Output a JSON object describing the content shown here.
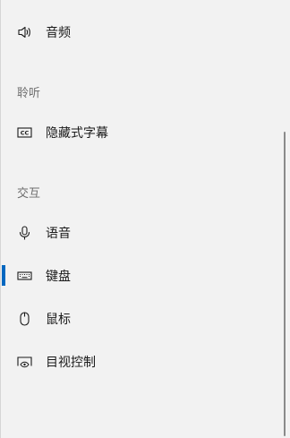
{
  "nav": {
    "audio": {
      "label": "音频",
      "icon": "speaker-icon"
    },
    "listening_header": "聆听",
    "captions": {
      "label": "隐藏式字幕",
      "icon": "closed-captions-icon"
    },
    "interaction_header": "交互",
    "speech": {
      "label": "语音",
      "icon": "microphone-icon"
    },
    "keyboard": {
      "label": "键盘",
      "icon": "keyboard-icon",
      "selected": true
    },
    "mouse": {
      "label": "鼠标",
      "icon": "mouse-icon"
    },
    "eye_control": {
      "label": "目视控制",
      "icon": "eye-control-icon"
    }
  },
  "colors": {
    "accent": "#0067c0",
    "background": "#f2f2f2",
    "text": "#1a1a1a",
    "section_header": "#6e6e6e"
  }
}
